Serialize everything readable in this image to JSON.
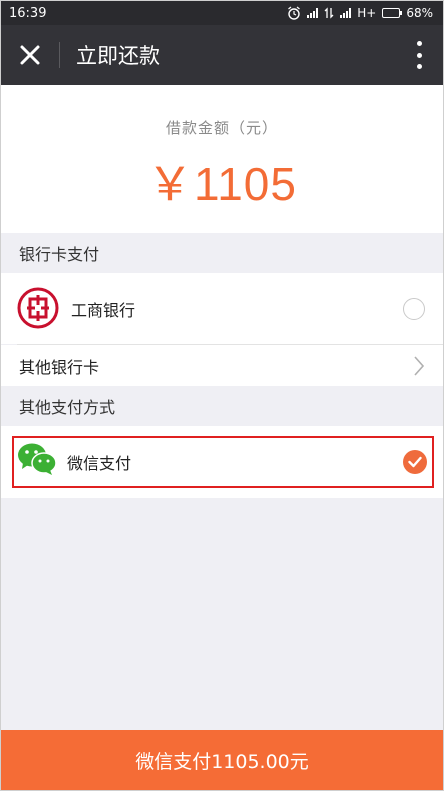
{
  "status_bar": {
    "time": "16:39",
    "network": "H+",
    "battery": "68%",
    "battery_level": 0.68
  },
  "header": {
    "title": "立即还款",
    "close_icon": "close-icon",
    "more_icon": "more-vertical-icon"
  },
  "amount": {
    "label": "借款金额（元）",
    "value": "￥1105"
  },
  "bank_card_section": {
    "header": "银行卡支付",
    "items": [
      {
        "label": "工商银行",
        "icon": "icbc-logo-icon",
        "selected": false
      },
      {
        "label": "其他银行卡",
        "icon": "chevron-right-icon"
      }
    ]
  },
  "other_payment_section": {
    "header": "其他支付方式",
    "items": [
      {
        "label": "微信支付",
        "icon": "wechat-icon",
        "selected": true
      }
    ]
  },
  "pay_button": {
    "label": "微信支付1105.00元"
  },
  "colors": {
    "accent": "#f56c36",
    "title_bar": "#333338",
    "highlight": "#e02020",
    "wechat_green": "#3cb034",
    "icbc_red": "#c8102e"
  }
}
